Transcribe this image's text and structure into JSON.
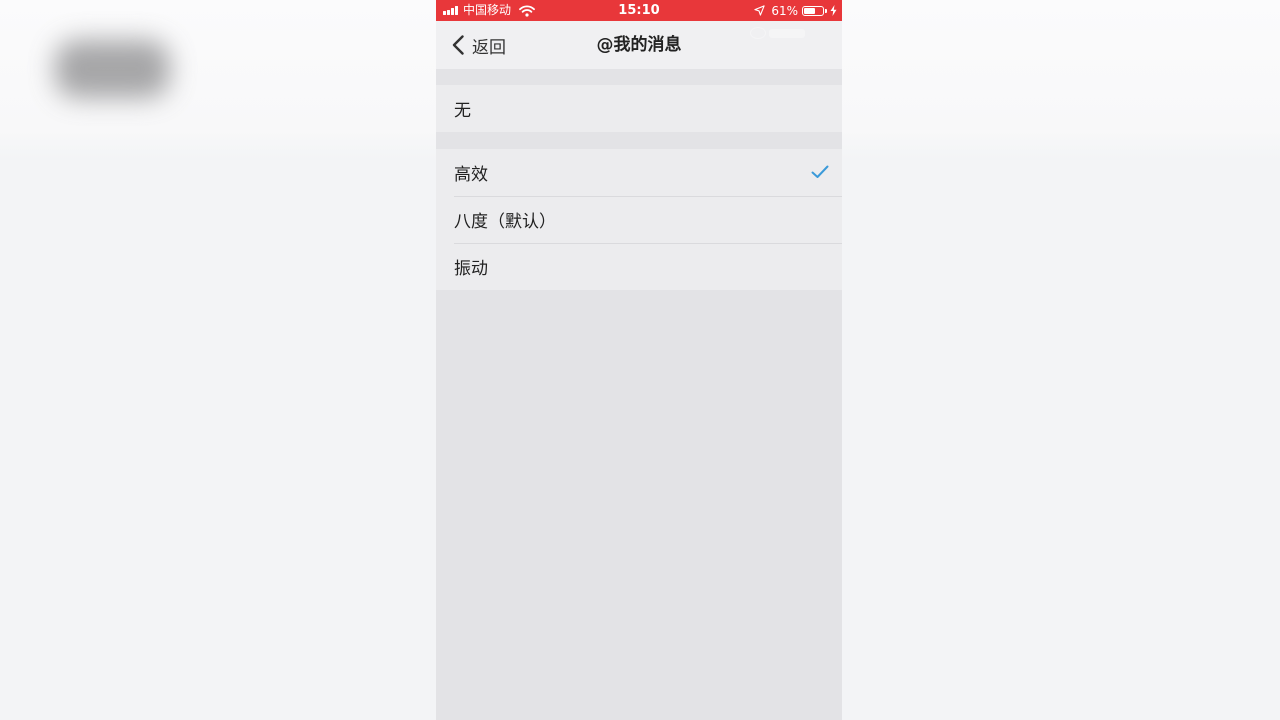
{
  "status_bar": {
    "carrier": "中国移动",
    "time": "15:10",
    "battery": "61%",
    "battery_level": 0.61
  },
  "nav": {
    "back_label": "返回",
    "title": "@我的消息"
  },
  "options": {
    "group1": [
      {
        "label": "无",
        "selected": false
      }
    ],
    "group2": [
      {
        "label": "高效",
        "selected": true
      },
      {
        "label": "八度（默认）",
        "selected": false
      },
      {
        "label": "振动",
        "selected": false
      }
    ]
  },
  "colors": {
    "status_bar": "#e8373a",
    "checkmark": "#3b9ad9",
    "list_background": "#ececee",
    "page_background": "#e3e3e6"
  },
  "icons": [
    "signal-icon",
    "wifi-icon",
    "location-arrow-icon",
    "battery-icon",
    "charging-bolt-icon",
    "chevron-left-icon",
    "checkmark-icon"
  ]
}
